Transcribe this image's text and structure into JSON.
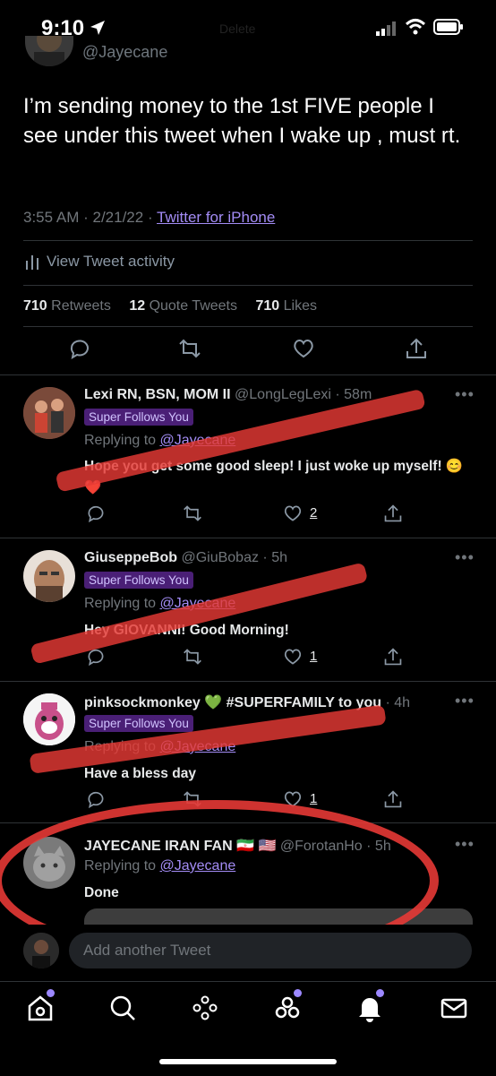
{
  "status_bar": {
    "time": "9:10",
    "ghost_title": "Delete"
  },
  "tweet": {
    "author_handle": "@Jayecane",
    "text": "I’m sending money to the 1st FIVE people I see under this tweet when I wake up , must rt.",
    "time": "3:55 AM",
    "date": "2/21/22",
    "source": "Twitter for iPhone",
    "activity_label": "View Tweet activity",
    "retweets": "710",
    "retweets_label": "Retweets",
    "quotes": "12",
    "quotes_label": "Quote Tweets",
    "likes": "710",
    "likes_label": "Likes"
  },
  "replies": [
    {
      "name": "Lexi RN, BSN, MOM II",
      "handle": "@LongLegLexi",
      "age": "58m",
      "badge": "Super Follows You",
      "replying_prefix": "Replying to",
      "replying_to": "@Jayecane",
      "text": "Hope you get some good sleep! I just woke up myself! 😊❤️",
      "likes": "2"
    },
    {
      "name": "GiuseppeBob",
      "handle": "@GiuBobaz",
      "age": "5h",
      "badge": "Super Follows You",
      "replying_prefix": "Replying to",
      "replying_to": "@Jayecane",
      "text": "Hey GIOVANNI! Good Morning!",
      "likes": "1"
    },
    {
      "name": "pinksockmonkey 💚 #SUPERFAMILY to you",
      "handle": "",
      "age": "4h",
      "badge": "Super Follows You",
      "replying_prefix": "Replying to",
      "replying_to": "@Jayecane",
      "text": "Have a bless day",
      "likes": "1"
    },
    {
      "name": "JAYECANE IRAN FAN 🇮🇷 🇺🇸",
      "handle": "@ForotanHo",
      "age": "5h",
      "replying_prefix": "Replying to",
      "replying_to": "@Jayecane",
      "text": "Done"
    }
  ],
  "compose": {
    "placeholder": "Add another Tweet"
  },
  "colors": {
    "background": "#000000",
    "accent_link": "#a38cf5",
    "badge_bg": "#4a1f76",
    "annotation_red": "#e53935",
    "tab_dot": "#9c88ff"
  },
  "icons": {
    "reply": "reply-icon",
    "retweet": "retweet-icon",
    "like": "heart-icon",
    "share": "share-icon",
    "more": "more-icon",
    "tabs": [
      "home-icon",
      "search-icon",
      "spaces-icon",
      "communities-icon",
      "notifications-icon",
      "messages-icon"
    ]
  }
}
